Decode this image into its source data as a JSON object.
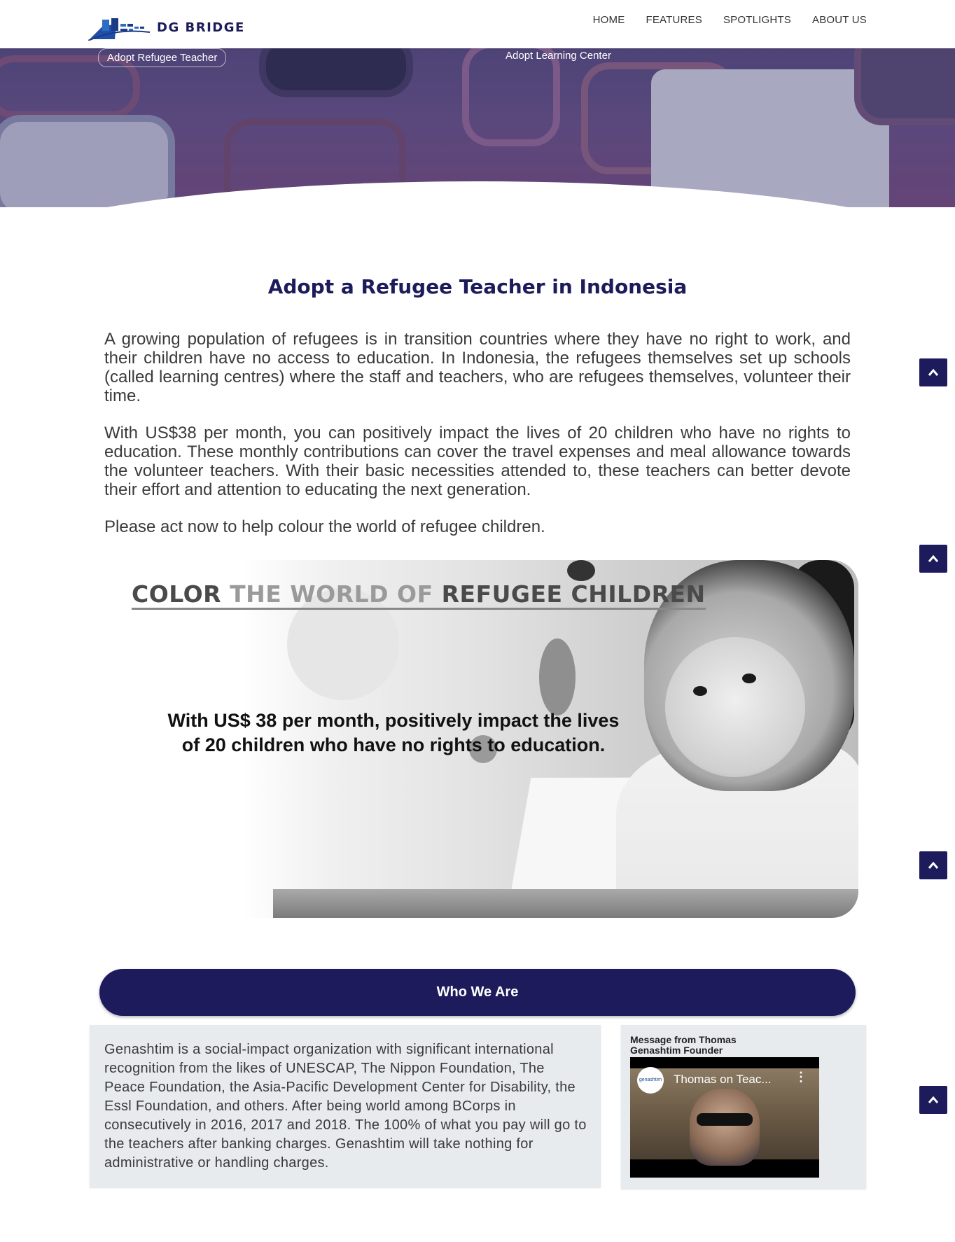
{
  "nav": {
    "brand": "DG BRIDGE",
    "items": [
      {
        "label": "HOME"
      },
      {
        "label": "FEATURES"
      },
      {
        "label": "SPOTLIGHTS"
      },
      {
        "label": "ABOUT US"
      }
    ]
  },
  "hero": {
    "left_label": "Adopt Refugee Teacher",
    "right_label": "Adopt Learning Center"
  },
  "main": {
    "title": "Adopt a Refugee Teacher in Indonesia",
    "paragraphs": [
      "A growing population of refugees is in transition countries where they have no right to work, and their children have no access to education. In Indonesia, the refugees themselves set up schools (called learning centres) where the staff and teachers, who are refugees themselves, volunteer their time.",
      "With US$38 per month, you can positively impact the lives of 20 children who have no rights to education. These monthly contributions can cover the travel expenses and meal allowance towards the volunteer teachers. With their basic necessities attended to, these teachers can better devote their effort and attention to educating the next generation.",
      "Please act now to help colour the world of refugee children."
    ]
  },
  "banner": {
    "headline_part1": "COLOR ",
    "headline_part2": "THE WORLD OF ",
    "headline_part3": "REFUGEE CHILDREN",
    "subtext_line1": "With US$ 38 per month, positively impact the lives",
    "subtext_line2": "of 20 children who have no rights to education."
  },
  "who": {
    "heading": "Who We Are",
    "text": "Genashtim is a social-impact organization with significant international recognition from the likes of UNESCAP, The Nippon Foundation, The Peace Foundation, the Asia-Pacific Development Center for Disability, the Essl Foundation, and others. After being world among BCorps in consecutively in 2016, 2017 and 2018. The 100% of what you pay will go to the teachers after banking charges. Genashtim will take nothing for administrative or handling charges.",
    "message_title_line1": "Message from Thomas",
    "message_title_line2": "Genashtim Founder",
    "video_channel": "genashtim",
    "video_title": "Thomas on Teac..."
  },
  "colors": {
    "brand_navy": "#1e1b5c",
    "title_navy": "#1c1c5a",
    "card_gray": "#e8ebee"
  },
  "icons": [
    "chevron-up-icon",
    "more-vert-icon"
  ]
}
